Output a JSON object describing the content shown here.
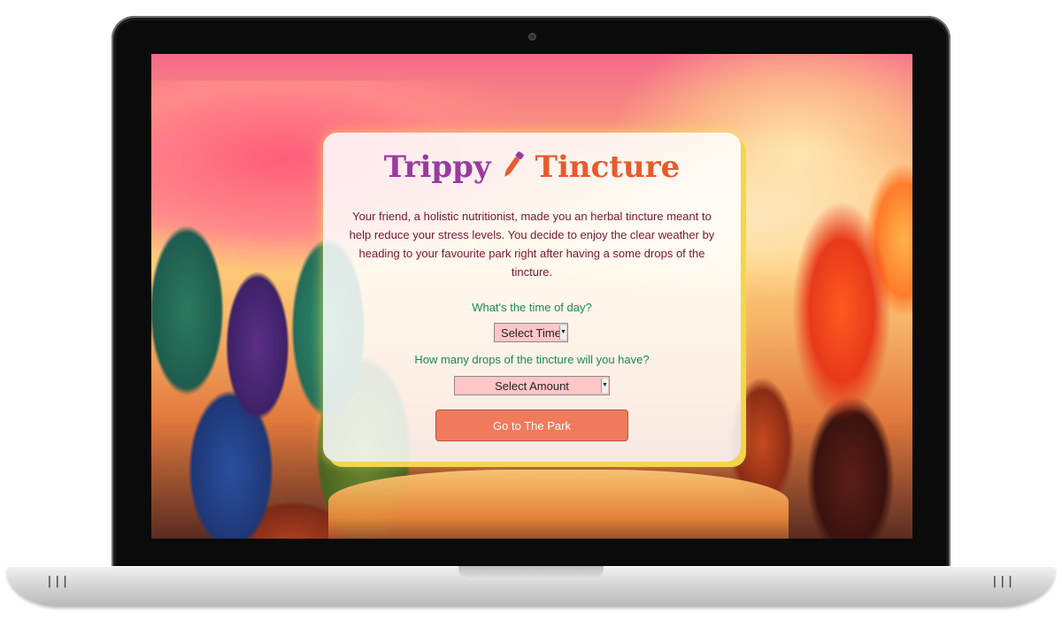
{
  "page": {
    "title_word_1": "Trippy",
    "title_word_2": "Tincture",
    "title_icon": "dropper-icon",
    "intro": "Your friend, a holistic nutritionist, made you an herbal tincture meant to help reduce your stress levels. You decide to enjoy the clear weather by heading to your favourite park right after having a some drops of the tincture."
  },
  "form": {
    "time_question": "What's the time of day?",
    "time_select": {
      "selected": "Select Time"
    },
    "drops_question": "How many drops of the tincture will you have?",
    "drops_select": {
      "selected": "Select Amount"
    },
    "submit_label": "Go to The Park"
  },
  "colors": {
    "title_primary": "#9a3aa0",
    "title_secondary": "#e85a2c",
    "intro_text": "#7a1430",
    "question_text": "#1a8a52",
    "select_bg": "#ffc6c8",
    "button_bg": "#f07a5c",
    "card_outline": "#f3d64a"
  }
}
